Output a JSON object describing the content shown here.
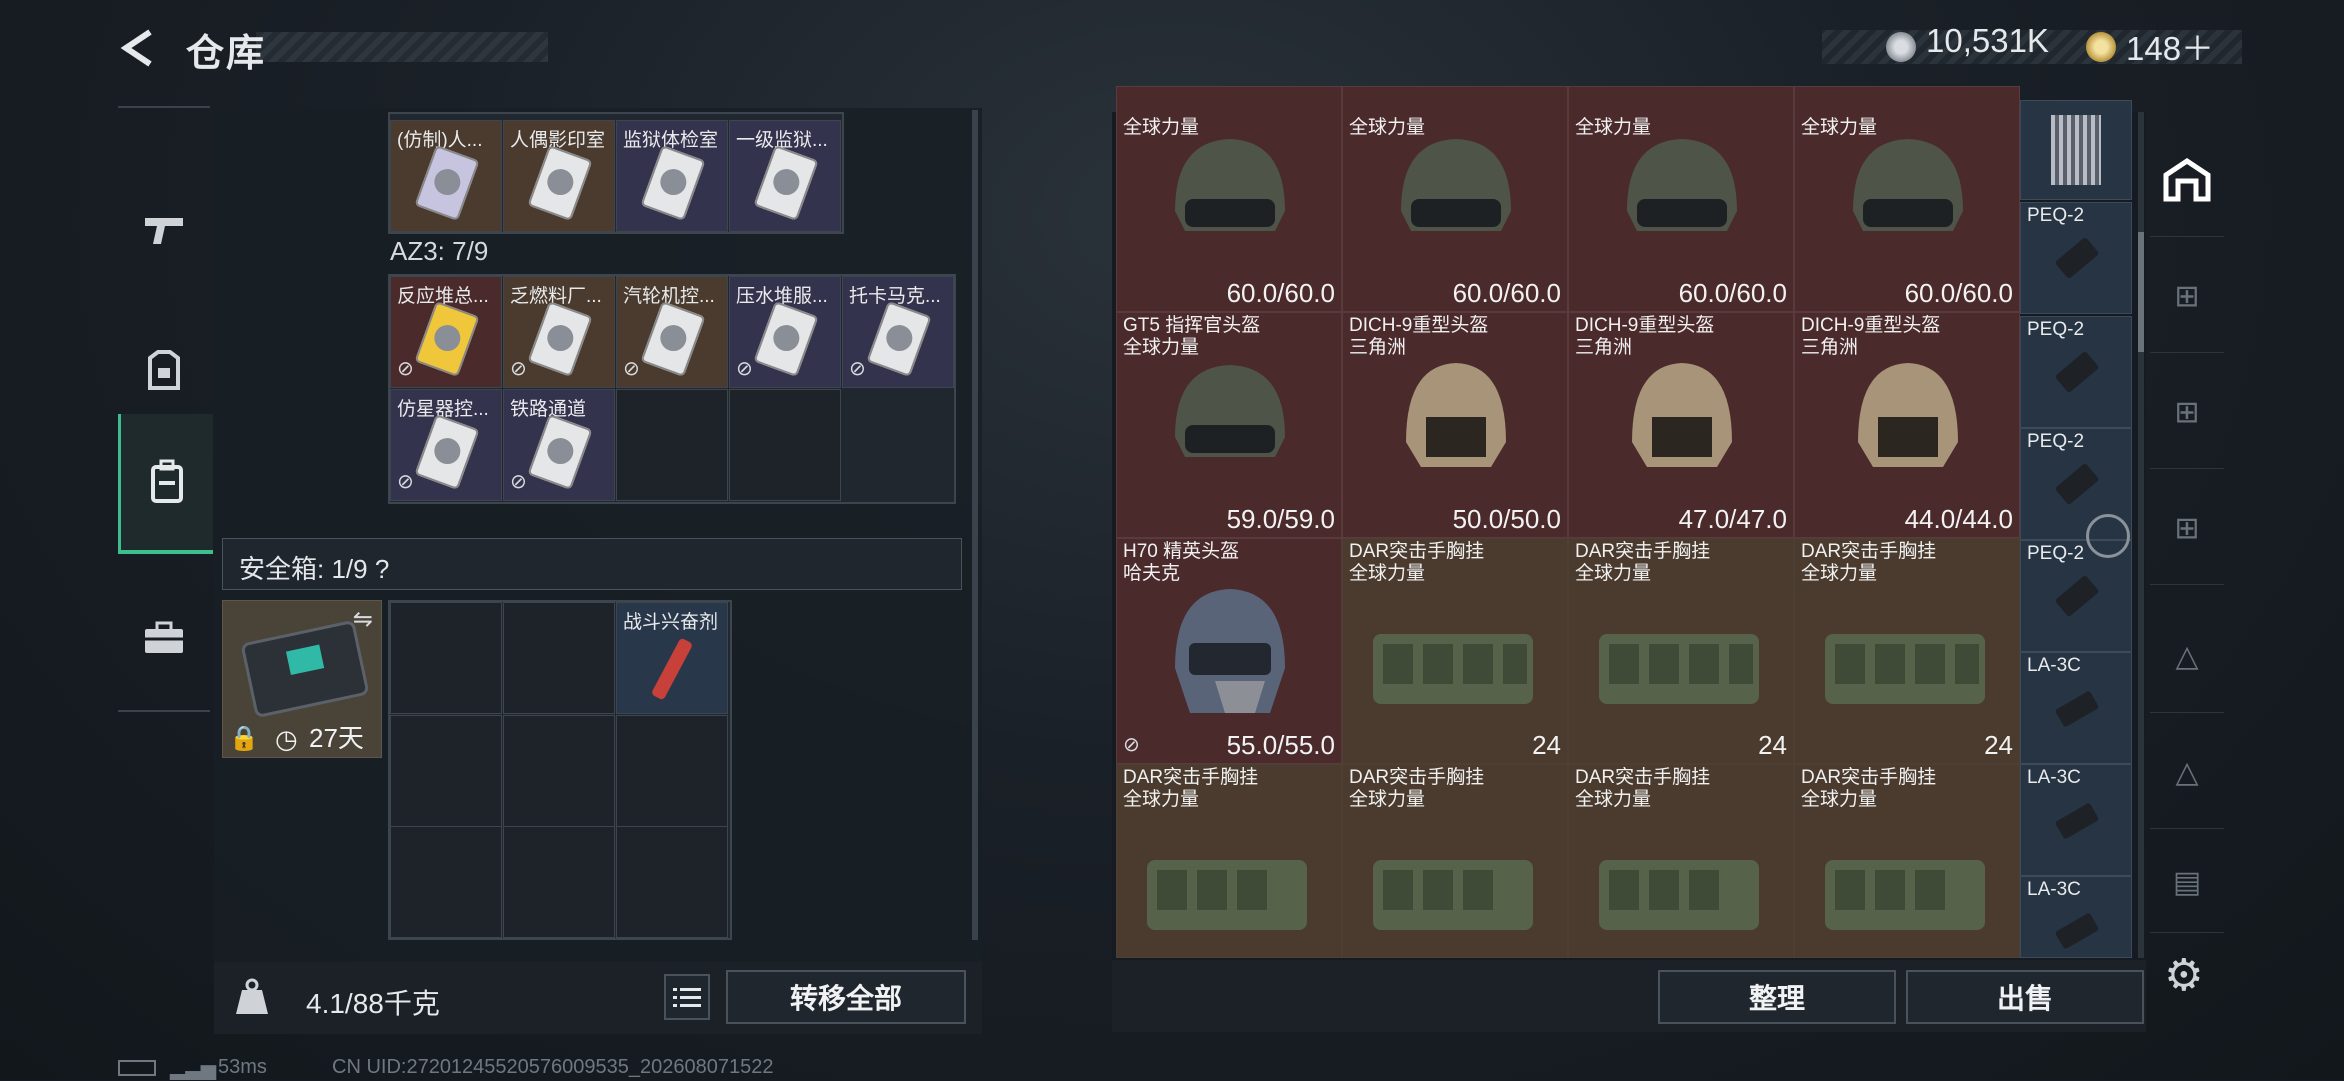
{
  "header": {
    "title": "仓库",
    "currency1": "10,531K",
    "currency2": "148＋"
  },
  "left": {
    "top_row": [
      "(仿制)人...",
      "人偶影印室",
      "监狱体检室",
      "一级监狱..."
    ],
    "az3_label": "AZ3: 7/9",
    "row2": [
      "反应堆总...",
      "乏燃料厂...",
      "汽轮机控...",
      "压水堆服...",
      "托卡马克..."
    ],
    "row3": [
      "仿星器控...",
      "铁路通道"
    ],
    "safe_label": "安全箱: 1/9 ?",
    "safe_days": "27天",
    "safe_item": "战斗兴奋剂",
    "weight": "4.1/88千克",
    "transfer_all": "转移全部"
  },
  "right": {
    "row1": [
      {
        "name": "全球力量",
        "val": "60.0/60.0"
      },
      {
        "name": "全球力量",
        "val": "60.0/60.0"
      },
      {
        "name": "全球力量",
        "val": "60.0/60.0"
      },
      {
        "name": "全球力量",
        "val": "60.0/60.0"
      }
    ],
    "row2": [
      {
        "name": "GT5 指挥官头盔",
        "sub": "全球力量",
        "val": "59.0/59.0"
      },
      {
        "name": "DICH-9重型头盔",
        "sub": "三角洲",
        "val": "50.0/50.0"
      },
      {
        "name": "DICH-9重型头盔",
        "sub": "三角洲",
        "val": "47.0/47.0"
      },
      {
        "name": "DICH-9重型头盔",
        "sub": "三角洲",
        "val": "44.0/44.0"
      }
    ],
    "row3": [
      {
        "name": "H70 精英头盔",
        "sub": "哈夫克",
        "val": "55.0/55.0"
      },
      {
        "name": "DAR突击手胸挂",
        "sub": "全球力量",
        "val": "24"
      },
      {
        "name": "DAR突击手胸挂",
        "sub": "全球力量",
        "val": "24"
      },
      {
        "name": "DAR突击手胸挂",
        "sub": "全球力量",
        "val": "24"
      }
    ],
    "row4": [
      {
        "name": "DAR突击手胸挂",
        "sub": "全球力量"
      },
      {
        "name": "DAR突击手胸挂",
        "sub": "全球力量"
      },
      {
        "name": "DAR突击手胸挂",
        "sub": "全球力量"
      },
      {
        "name": "DAR突击手胸挂",
        "sub": "全球力量"
      }
    ],
    "side_col": [
      "PEQ-2",
      "PEQ-2",
      "PEQ-2",
      "PEQ-2",
      "LA-3C",
      "LA-3C",
      "LA-3C"
    ],
    "sort_btn": "整理",
    "sell_btn": "出售"
  },
  "footer": {
    "ping": "53ms",
    "uid": "CN UID:272012455205760095​35_202608071522"
  }
}
